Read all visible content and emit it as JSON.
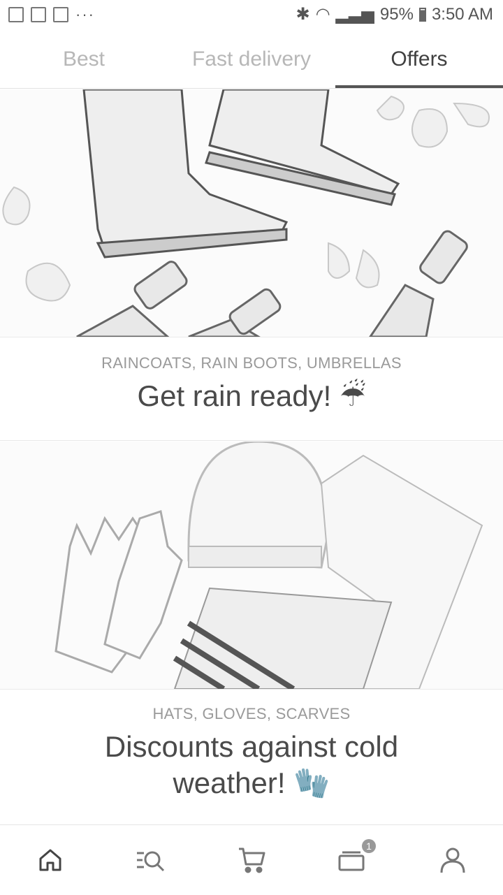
{
  "status_bar": {
    "battery": "95%",
    "time": "3:50 AM",
    "more": "···"
  },
  "tabs": [
    {
      "label": "Best",
      "active": false
    },
    {
      "label": "Fast delivery",
      "active": false
    },
    {
      "label": "Offers",
      "active": true
    }
  ],
  "offers": [
    {
      "subtitle": "RAINCOATS, RAIN BOOTS, UMBRELLAS",
      "title": "Get rain ready! ☔",
      "image_desc_icon": "rain-boots-umbrellas-image"
    },
    {
      "subtitle": "HATS, GLOVES, SCARVES",
      "title_line1": "Discounts against cold",
      "title_line2": "weather! 🧤",
      "image_desc_icon": "hat-gloves-scarf-image"
    }
  ],
  "bottom_nav": {
    "items": [
      "home-icon",
      "search-list-icon",
      "cart-icon",
      "orders-icon",
      "profile-icon"
    ],
    "orders_badge": "1"
  },
  "colors": {
    "active_tab": "#404040",
    "inactive_tab": "#b7b7b7",
    "subtitle": "#9a9a9a",
    "title": "#4a4a4a",
    "icon": "#555555"
  }
}
